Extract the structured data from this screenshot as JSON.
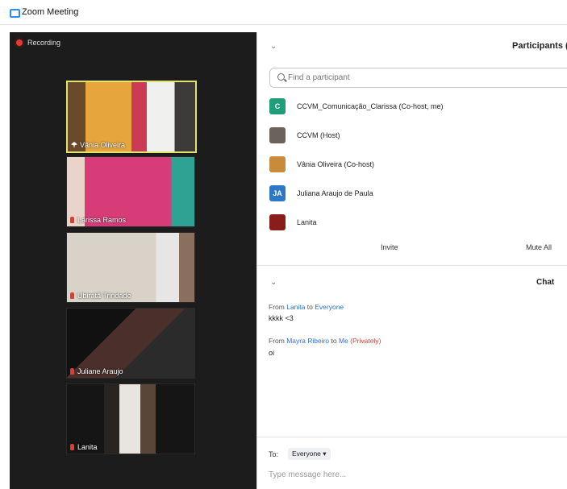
{
  "window": {
    "title": "Zoom Meeting"
  },
  "recording": {
    "label": "Recording"
  },
  "videos": [
    {
      "name": "Vânia Oliveira",
      "active": true
    },
    {
      "name": "Larissa Ramos"
    },
    {
      "name": "Ubiratã Trindade"
    },
    {
      "name": "Juliane Araujo"
    },
    {
      "name": "Lanita"
    }
  ],
  "participants": {
    "title": "Participants (",
    "search_placeholder": "Find a participant",
    "list": [
      {
        "initial": "C",
        "avatar_color": "#1f9d7a",
        "name": "CCVM_Comunicação_Clarissa (Co-host, me)"
      },
      {
        "initial": "",
        "avatar_color": "#6b625c",
        "name": "CCVM (Host)"
      },
      {
        "initial": "",
        "avatar_color": "#c88a3b",
        "name": "Vânia Oliveira (Co-host)"
      },
      {
        "initial": "JA",
        "avatar_color": "#2d79c7",
        "name": "Juliana Araujo de Paula"
      },
      {
        "initial": "",
        "avatar_color": "#8a1c1c",
        "name": "Lanita"
      }
    ],
    "invite_label": "Invite",
    "mute_all_label": "Mute All"
  },
  "chat": {
    "title": "Chat",
    "messages": [
      {
        "from_prefix": "From",
        "sender": "Lanita",
        "to_word": "to",
        "recipient": "Everyone",
        "private_tag": "",
        "text": "kkkk <3"
      },
      {
        "from_prefix": "From",
        "sender": "Mayra Ribeiro",
        "to_word": "to",
        "recipient": "Me",
        "private_tag": "(Privately)",
        "text": "oi"
      }
    ],
    "to_label": "To:",
    "to_value": "Everyone",
    "input_placeholder": "Type message here..."
  },
  "colors": {
    "accent": "#2d8cff",
    "video_bg": "#1c1c1c",
    "active_border": "#e0e36e",
    "record": "#e03c31"
  }
}
